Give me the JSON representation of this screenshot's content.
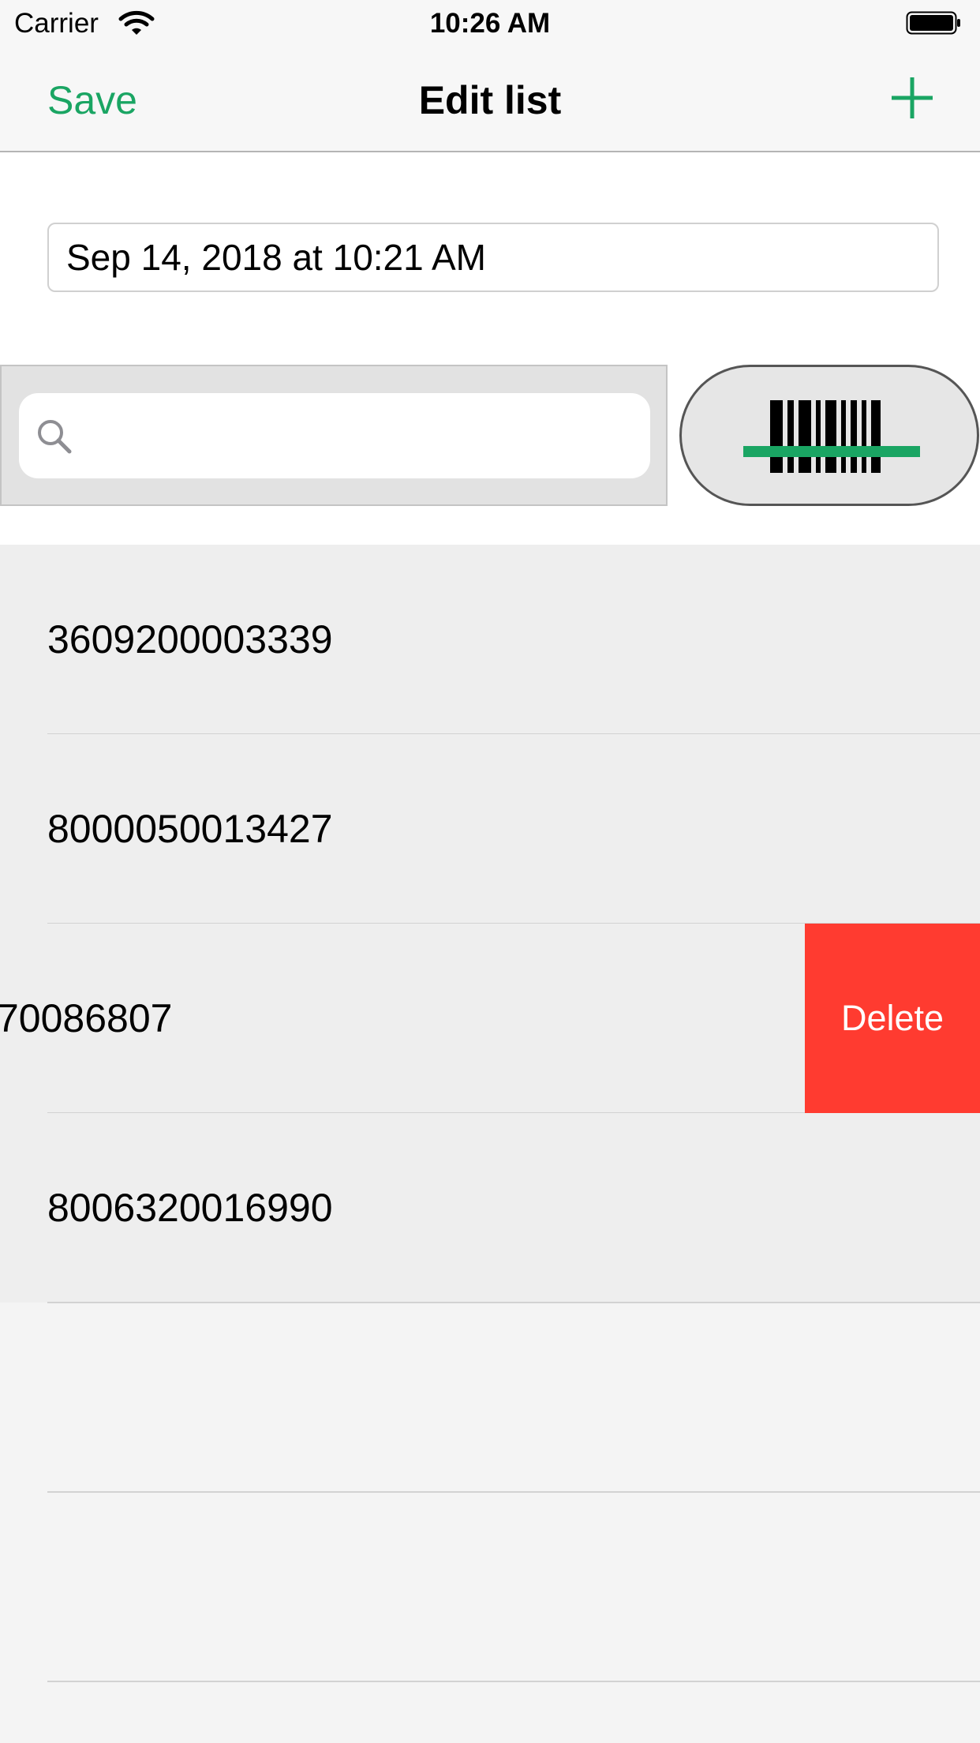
{
  "status_bar": {
    "carrier": "Carrier",
    "time": "10:26 AM"
  },
  "nav": {
    "save_label": "Save",
    "title": "Edit list",
    "add_icon": "plus-icon"
  },
  "date_field": {
    "value": "Sep 14, 2018 at 10:21 AM"
  },
  "search": {
    "placeholder": "",
    "icon": "search-icon"
  },
  "scan_button": {
    "icon": "barcode-scan-icon"
  },
  "items": [
    {
      "code": "3609200003339"
    },
    {
      "code": "8000050013427"
    },
    {
      "code": "70086807"
    },
    {
      "code": "8006320016990"
    }
  ],
  "swipe_action": {
    "delete_label": "Delete"
  },
  "colors": {
    "accent": "#1aa563",
    "delete": "#ff3b30"
  }
}
